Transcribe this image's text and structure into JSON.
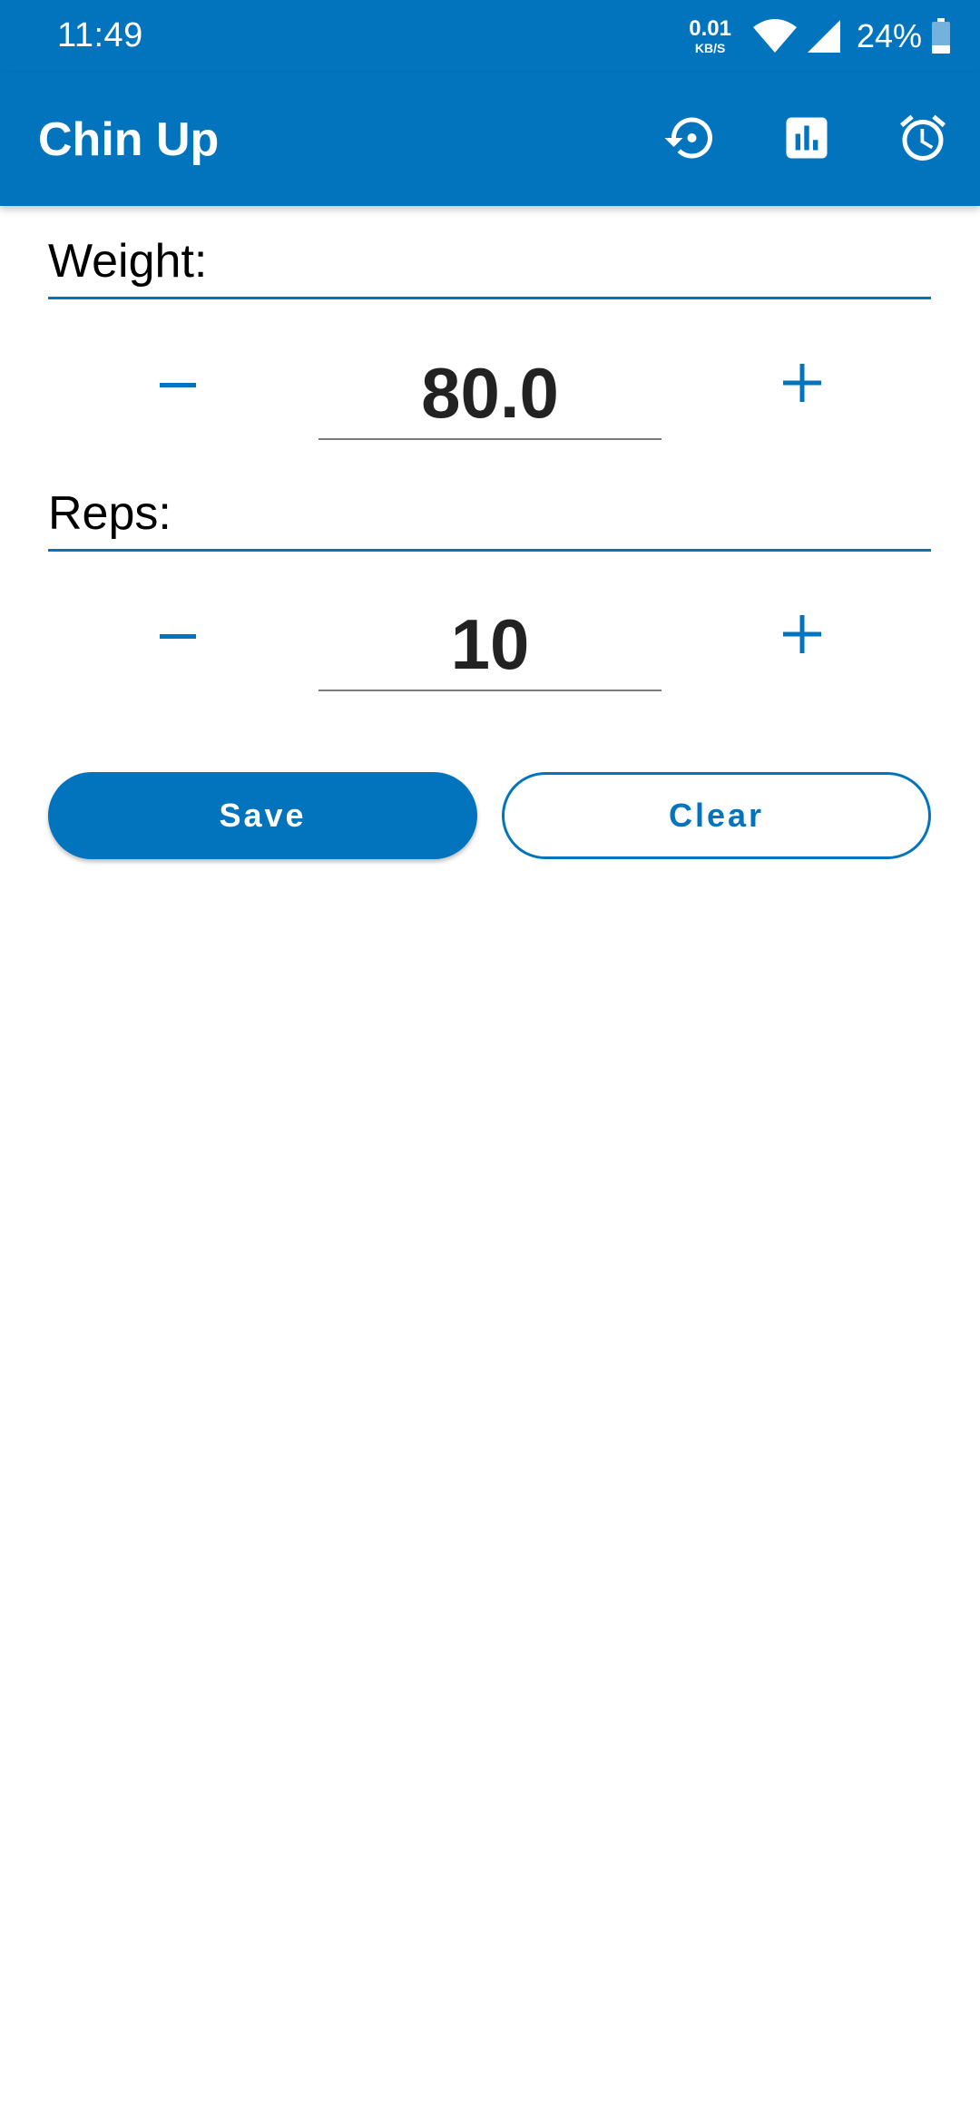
{
  "status_bar": {
    "time": "11:49",
    "net_speed_value": "0.01",
    "net_speed_unit": "KB/S",
    "battery_percent": "24%",
    "icons": [
      "wifi-icon",
      "signal-icon",
      "battery-icon"
    ]
  },
  "app_bar": {
    "title": "Chin Up",
    "actions": [
      {
        "name": "history-icon"
      },
      {
        "name": "bar-chart-icon"
      },
      {
        "name": "alarm-clock-icon"
      }
    ]
  },
  "form": {
    "weight": {
      "label": "Weight:",
      "value": "80.0"
    },
    "reps": {
      "label": "Reps:",
      "value": "10"
    }
  },
  "buttons": {
    "save_label": "Save",
    "clear_label": "Clear"
  },
  "colors": {
    "primary": "#0274BE",
    "text_dark": "#222222",
    "background": "#ffffff"
  }
}
